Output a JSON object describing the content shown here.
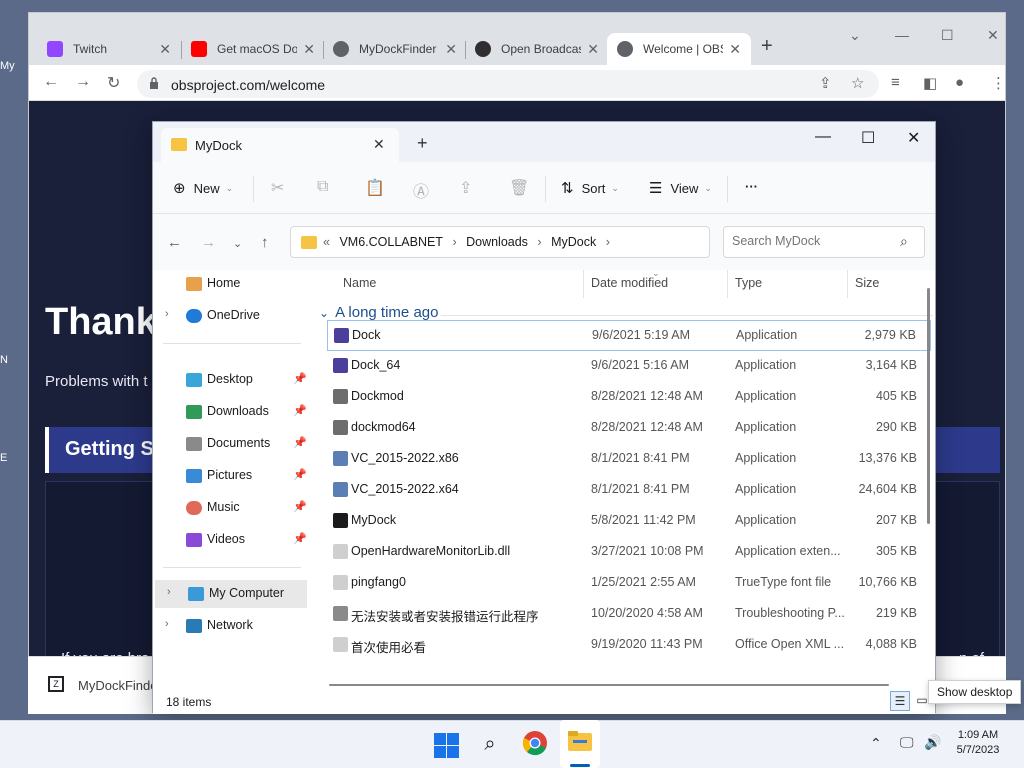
{
  "desktop": {
    "frag1": "My",
    "frag2": "N",
    "frag3": "E"
  },
  "chrome": {
    "tabs": [
      {
        "title": "Twitch",
        "color": "#9146ff"
      },
      {
        "title": "Get macOS Dock",
        "color": "#ff0000"
      },
      {
        "title": "MyDockFinder",
        "color": "#5f6368"
      },
      {
        "title": "Open Broadcaster",
        "color": "#302e31"
      },
      {
        "title": "Welcome | OBS",
        "color": "#5f6368"
      }
    ],
    "url": "obsproject.com/welcome"
  },
  "obs_page": {
    "heading": "Thank",
    "sub": "Problems with t",
    "getting_started": "Getting S",
    "brand_text": "If you are bra",
    "brand_text_end": "n of"
  },
  "download_bar": {
    "file": "MyDockFinde"
  },
  "explorer": {
    "tab_title": "MyDock",
    "commands": {
      "new": "New",
      "sort": "Sort",
      "view": "View",
      "more": "···"
    },
    "breadcrumb": [
      "VM6.COLLABNET",
      "Downloads",
      "MyDock"
    ],
    "breadcrumb_prefix": "«",
    "search_placeholder": "Search MyDock",
    "sidebar": {
      "home": "Home",
      "onedrive": "OneDrive",
      "desktop": "Desktop",
      "downloads": "Downloads",
      "documents": "Documents",
      "pictures": "Pictures",
      "music": "Music",
      "videos": "Videos",
      "my_computer": "My Computer",
      "network": "Network"
    },
    "columns": {
      "name": "Name",
      "date": "Date modified",
      "type": "Type",
      "size": "Size"
    },
    "group": "A long time ago",
    "files": [
      {
        "name": "Dock",
        "date": "9/6/2021 5:19 AM",
        "type": "Application",
        "size": "2,979 KB",
        "icon": "#4a3f9a"
      },
      {
        "name": "Dock_64",
        "date": "9/6/2021 5:16 AM",
        "type": "Application",
        "size": "3,164 KB",
        "icon": "#4a3f9a"
      },
      {
        "name": "Dockmod",
        "date": "8/28/2021 12:48 AM",
        "type": "Application",
        "size": "405 KB",
        "icon": "#6d6d6d"
      },
      {
        "name": "dockmod64",
        "date": "8/28/2021 12:48 AM",
        "type": "Application",
        "size": "290 KB",
        "icon": "#6d6d6d"
      },
      {
        "name": "VC_2015-2022.x86",
        "date": "8/1/2021 8:41 PM",
        "type": "Application",
        "size": "13,376 KB",
        "icon": "#5b7fb5"
      },
      {
        "name": "VC_2015-2022.x64",
        "date": "8/1/2021 8:41 PM",
        "type": "Application",
        "size": "24,604 KB",
        "icon": "#5b7fb5"
      },
      {
        "name": "MyDock",
        "date": "5/8/2021 11:42 PM",
        "type": "Application",
        "size": "207 KB",
        "icon": "#1b1b1b"
      },
      {
        "name": "OpenHardwareMonitorLib.dll",
        "date": "3/27/2021 10:08 PM",
        "type": "Application exten...",
        "size": "305 KB",
        "icon": "#cfcfcf"
      },
      {
        "name": "pingfang0",
        "date": "1/25/2021 2:55 AM",
        "type": "TrueType font file",
        "size": "10,766 KB",
        "icon": "#cfcfcf"
      },
      {
        "name": "无法安装或者安装报错运行此程序",
        "date": "10/20/2020 4:58 AM",
        "type": "Troubleshooting P...",
        "size": "219 KB",
        "icon": "#8a8a8a"
      },
      {
        "name": "首次使用必看",
        "date": "9/19/2020 11:43 PM",
        "type": "Office Open XML ...",
        "size": "4,088 KB",
        "icon": "#cfcfcf"
      }
    ],
    "status": "18 items"
  },
  "tooltip": "Show desktop",
  "taskbar": {
    "time": "1:09 AM",
    "date": "5/7/2023"
  }
}
